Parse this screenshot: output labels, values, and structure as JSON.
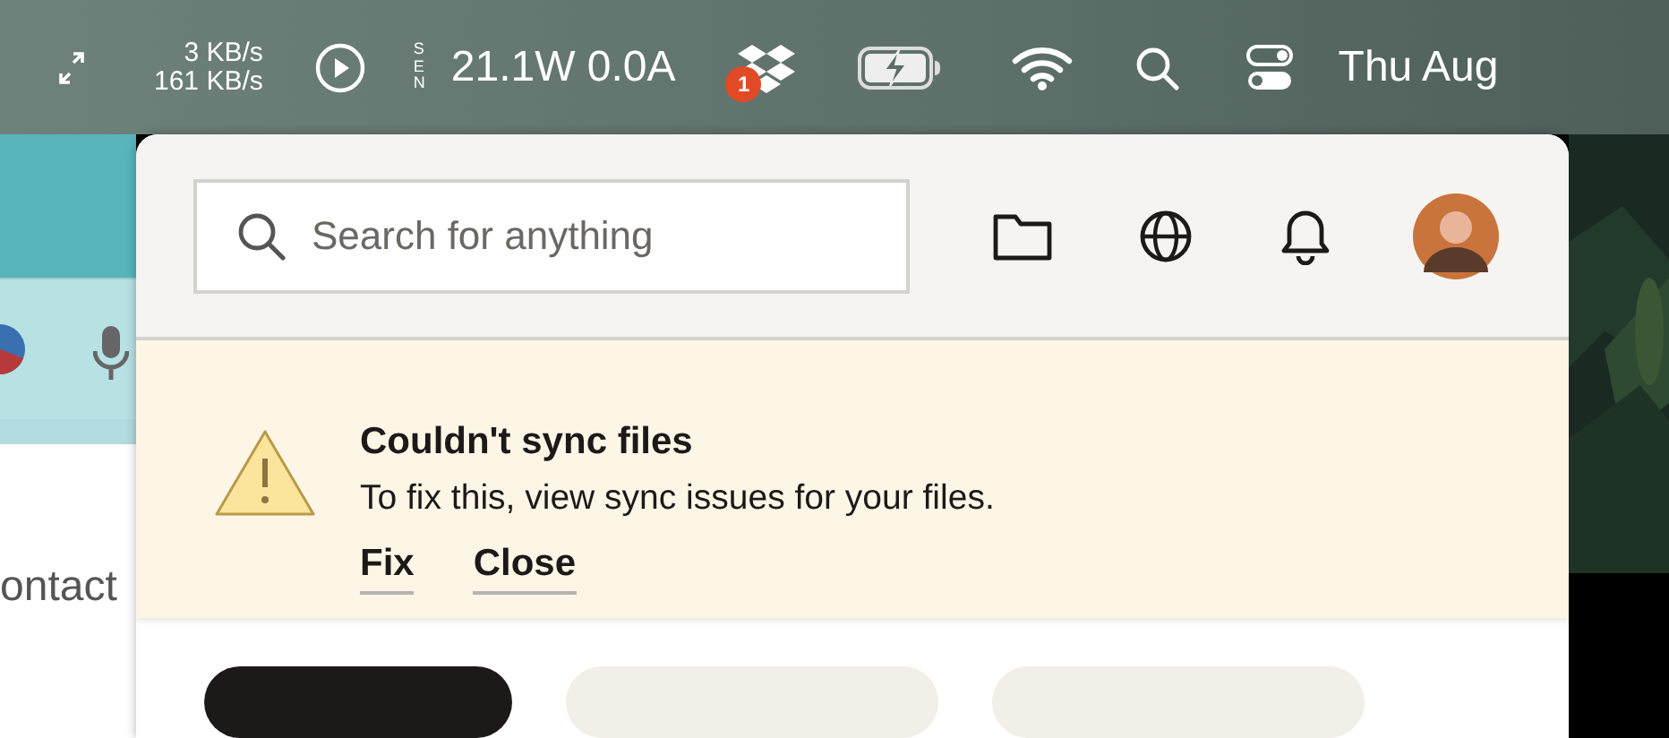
{
  "menu_bar": {
    "network_up": "3 KB/s",
    "network_down": "161 KB/s",
    "power_label": "SEN",
    "power_reading": "21.1W 0.0A",
    "notification_badge": "1",
    "clock": "Thu Aug"
  },
  "background_window": {
    "text": "ontact"
  },
  "popup": {
    "search": {
      "placeholder": "Search for anything"
    },
    "alert": {
      "title": "Couldn't sync files",
      "message": "To fix this, view sync issues for your files.",
      "actions": [
        "Fix",
        "Close"
      ]
    },
    "filters": [
      {
        "selected": true
      },
      {
        "selected": false
      },
      {
        "selected": false
      }
    ]
  }
}
